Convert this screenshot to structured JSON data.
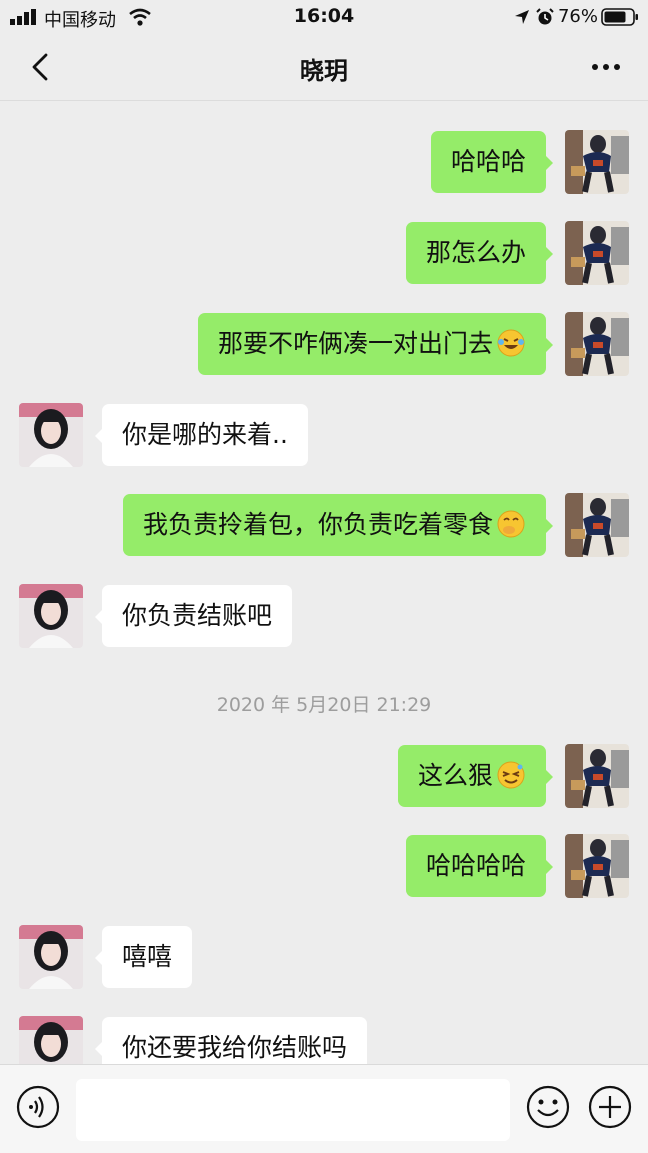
{
  "status_bar": {
    "carrier": "中国移动",
    "time": "16:04",
    "battery": "76%"
  },
  "header": {
    "title": "晓玥"
  },
  "messages": [
    {
      "side": "right",
      "text": "哈哈哈"
    },
    {
      "side": "right",
      "text": "那怎么办"
    },
    {
      "side": "right",
      "text": "那要不咋俩凑一对出门去",
      "emoji": "rolling-on-floor-laughing-emoji"
    },
    {
      "side": "left",
      "text": "你是哪的来着.."
    },
    {
      "side": "right",
      "text": "我负责拎着包，你负责吃着零食",
      "emoji": "giggling-emoji"
    },
    {
      "side": "left",
      "text": "你负责结账吧"
    },
    {
      "side": "right",
      "text": "这么狠",
      "emoji": "squinting-smirk-emoji"
    },
    {
      "side": "right",
      "text": "哈哈哈哈"
    },
    {
      "side": "left",
      "text": "嘻嘻"
    },
    {
      "side": "left",
      "text": "你还要我给你结账吗"
    }
  ],
  "timestamp": "2020 年 5月20日 21:29",
  "input_bar": {
    "placeholder": ""
  },
  "colors": {
    "sent_bubble": "#95ec69",
    "received_bubble": "#ffffff",
    "background": "#ededed"
  }
}
